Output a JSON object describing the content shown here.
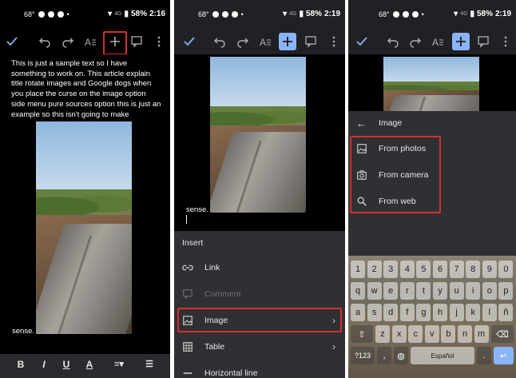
{
  "status": {
    "temp": "68°",
    "battery_1": "58%",
    "time_1": "2:16",
    "battery_2": "58%",
    "time_2": "2:19",
    "battery_3": "58%",
    "time_3": "2:19"
  },
  "toolbar": {
    "icons": [
      "check-icon",
      "undo-icon",
      "redo-icon",
      "text-format-icon",
      "insert-plus-icon",
      "comment-icon",
      "more-icon"
    ]
  },
  "panel1": {
    "body_text": "This is just a sample text so I have something to work on. This article explain title rotate images and Google dogs when you place the curse on the image option side menu pure sources option this is just an example so this isn't going to make",
    "sense_text": "sense.",
    "format_bar": [
      "B",
      "I",
      "U",
      "A"
    ]
  },
  "panel2": {
    "sense_text": "sense.",
    "insert_title": "Insert",
    "items": [
      {
        "label": "Link",
        "icon": "link-icon",
        "enabled": true
      },
      {
        "label": "Comment",
        "icon": "comment-icon",
        "enabled": false
      },
      {
        "label": "Image",
        "icon": "image-icon",
        "enabled": true,
        "chevron": true
      },
      {
        "label": "Table",
        "icon": "table-icon",
        "enabled": true,
        "chevron": true
      },
      {
        "label": "Horizontal line",
        "icon": "horizontal-line-icon",
        "enabled": true
      }
    ]
  },
  "panel3": {
    "title": "Image",
    "items": [
      {
        "label": "From photos",
        "icon": "photo-icon"
      },
      {
        "label": "From camera",
        "icon": "camera-icon"
      },
      {
        "label": "From web",
        "icon": "search-icon"
      }
    ],
    "keyboard": {
      "row1": [
        "1",
        "2",
        "3",
        "4",
        "5",
        "6",
        "7",
        "8",
        "9",
        "0"
      ],
      "row2": [
        "q",
        "w",
        "e",
        "r",
        "t",
        "y",
        "u",
        "i",
        "o",
        "p"
      ],
      "row3": [
        "a",
        "s",
        "d",
        "f",
        "g",
        "h",
        "j",
        "k",
        "l",
        "ñ"
      ],
      "row4": [
        "z",
        "x",
        "c",
        "v",
        "b",
        "n",
        "m"
      ],
      "bottom": [
        "?123",
        ",",
        "Español",
        "."
      ]
    }
  },
  "colors": {
    "accent": "#8ab4f8",
    "highlight": "#d32f2f",
    "sheet": "#2f3033"
  }
}
